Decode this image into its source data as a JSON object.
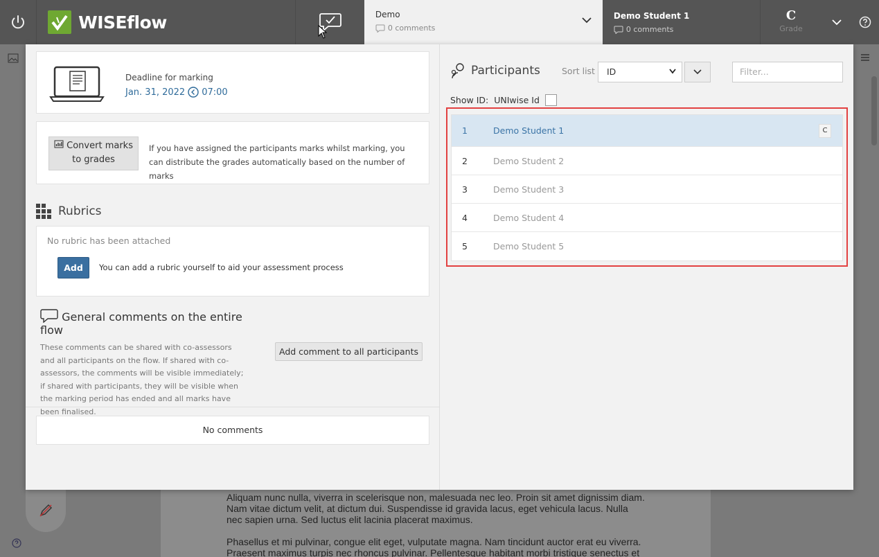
{
  "topbar": {
    "logo_text": "WISEflow",
    "flow": {
      "title": "Demo",
      "comments": "0 comments"
    },
    "student": {
      "title": "Demo Student 1",
      "comments": "0 comments"
    },
    "grade": {
      "value": "C",
      "label": "Grade"
    }
  },
  "deadline": {
    "label": "Deadline for marking",
    "date": "Jan. 31, 2022",
    "time": "07:00"
  },
  "convert": {
    "button_line1": "Convert marks",
    "button_line2": "to grades",
    "description": "If you have assigned the participants marks whilst marking, you can distribute the grades automatically based on the number of marks"
  },
  "rubrics": {
    "heading": "Rubrics",
    "empty_text": "No rubric has been attached",
    "add_label": "Add",
    "add_description": "You can add a rubric yourself to aid your assessment process"
  },
  "general_comments": {
    "heading": "General comments on the entire flow",
    "description": "These comments can be shared with co-assessors and all participants on the flow. If shared with co-assessors, the comments will be visible immediately; if shared with participants, they will be visible when the marking period has ended and all marks have been finalised.",
    "add_button": "Add comment to all participants",
    "no_comments": "No comments"
  },
  "participants": {
    "heading": "Participants",
    "sort_label": "Sort list",
    "sort_value": "ID",
    "filter_placeholder": "Filter...",
    "show_id_label": "Show ID:",
    "uniwise_label": "UNIwise Id",
    "rows": [
      {
        "id": "1",
        "name": "Demo Student 1",
        "grade": "C"
      },
      {
        "id": "2",
        "name": "Demo Student 2"
      },
      {
        "id": "3",
        "name": "Demo Student 3"
      },
      {
        "id": "4",
        "name": "Demo Student 4"
      },
      {
        "id": "5",
        "name": "Demo Student 5"
      }
    ]
  },
  "background_doc": {
    "para1": "Aliquam nunc nulla, viverra in scelerisque non, malesuada nec leo. Proin sit amet dignissim diam. Nam vitae dictum velit, at dictum dui. Suspendisse id gravida lacus, eget vehicula lacus. Nulla nec sapien urna. Sed luctus elit lacinia placerat maximus.",
    "para2": "Phasellus et mi pulvinar, congue elit eget, vulputate magna. Nam tincidunt auctor erat eu viverra. Praesent maximus turpis nec rhoncus pulvinar. Pellentesque habitant morbi tristique senectus et"
  },
  "colors": {
    "accent": "#3a6fa0",
    "brand_green": "#6fa832",
    "highlight": "#e24141"
  }
}
